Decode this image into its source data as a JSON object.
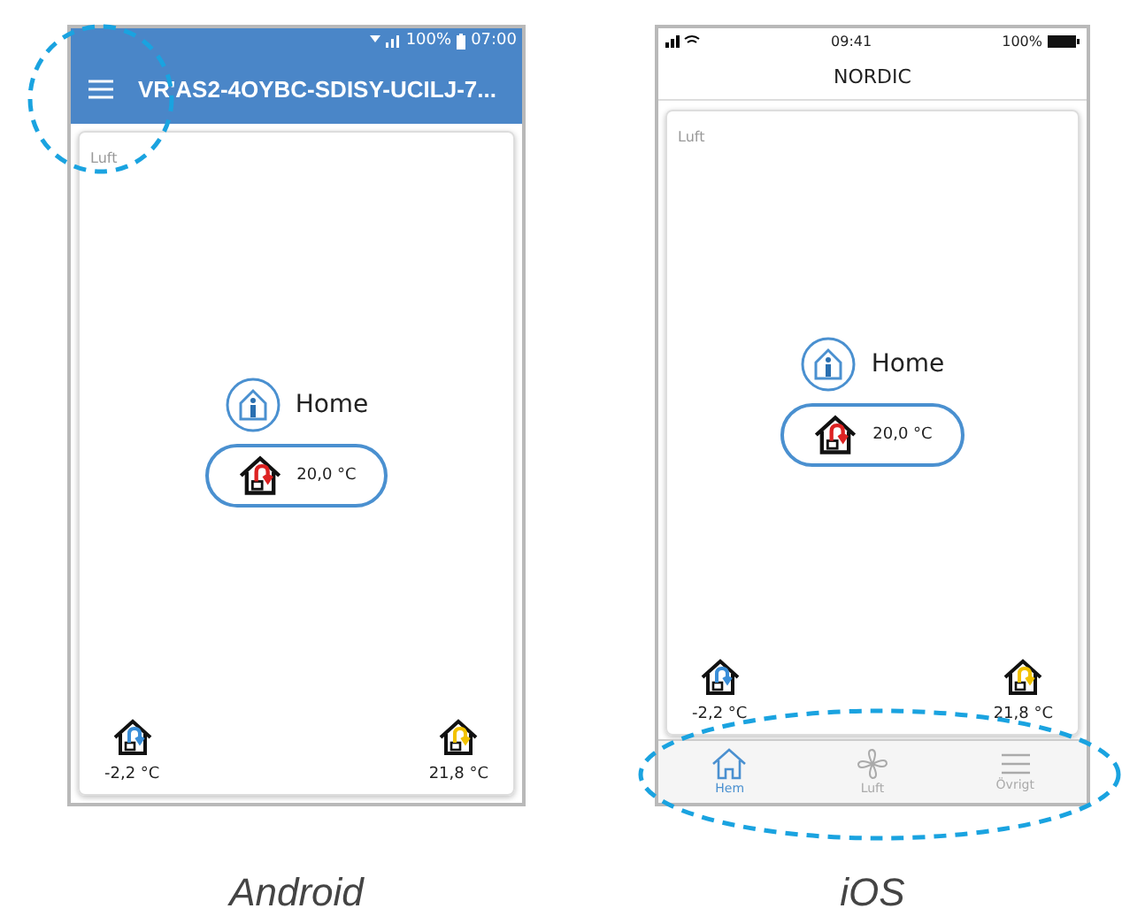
{
  "android": {
    "status": {
      "battery": "100%",
      "time": "07:00"
    },
    "title": "VR'AS2-4OYBC-SDISY-UCILJ-7...",
    "card_title": "Luft",
    "mode": "Home",
    "indoor": "20,0 °C",
    "outdoor": "-2,2 °C",
    "supply": "21,8 °C"
  },
  "ios": {
    "status": {
      "time": "09:41",
      "battery": "100%"
    },
    "title": "NORDIC",
    "card_title": "Luft",
    "mode": "Home",
    "indoor": "20,0 °C",
    "outdoor": "-2,2 °C",
    "supply": "21,8 °C",
    "tabs": [
      {
        "label": "Hem",
        "selected": true,
        "kind": "home"
      },
      {
        "label": "Luft",
        "selected": false,
        "kind": "fan"
      },
      {
        "label": "Övrigt",
        "selected": false,
        "kind": "menu"
      }
    ]
  },
  "captions": [
    "Android",
    "iOS"
  ]
}
